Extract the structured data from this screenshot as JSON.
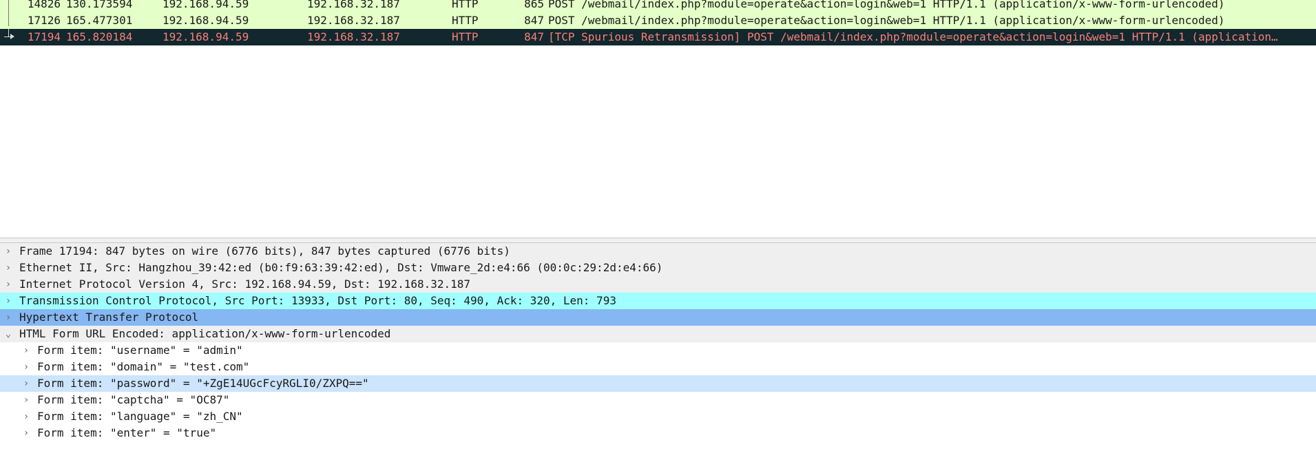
{
  "packet_list": {
    "rows": [
      {
        "no": "14826",
        "time": "130.173594",
        "src": "192.168.94.59",
        "dst": "192.168.32.187",
        "proto": "HTTP",
        "len": "865",
        "info": "POST /webmail/index.php?module=operate&action=login&web=1 HTTP/1.1  (application/x-www-form-urlencoded)"
      },
      {
        "no": "17126",
        "time": "165.477301",
        "src": "192.168.94.59",
        "dst": "192.168.32.187",
        "proto": "HTTP",
        "len": "847",
        "info": "POST /webmail/index.php?module=operate&action=login&web=1 HTTP/1.1  (application/x-www-form-urlencoded)"
      },
      {
        "no": "17194",
        "time": "165.820184",
        "src": "192.168.94.59",
        "dst": "192.168.32.187",
        "proto": "HTTP",
        "len": "847",
        "info": "[TCP Spurious Retransmission] POST /webmail/index.php?module=operate&action=login&web=1 HTTP/1.1  (application…"
      }
    ]
  },
  "packet_details": {
    "frame": "Frame 17194: 847 bytes on wire (6776 bits), 847 bytes captured (6776 bits)",
    "ethernet": "Ethernet II, Src: Hangzhou_39:42:ed (b0:f9:63:39:42:ed), Dst: Vmware_2d:e4:66 (00:0c:29:2d:e4:66)",
    "ip": "Internet Protocol Version 4, Src: 192.168.94.59, Dst: 192.168.32.187",
    "tcp": "Transmission Control Protocol, Src Port: 13933, Dst Port: 80, Seq: 490, Ack: 320, Len: 793",
    "http": "Hypertext Transfer Protocol",
    "form": "HTML Form URL Encoded: application/x-www-form-urlencoded",
    "form_items": [
      "Form item: \"username\" = \"admin\"",
      "Form item: \"domain\" = \"test.com\"",
      "Form item: \"password\" = \"+ZgE14UGcFcyRGLI0/ZXPQ==\"",
      "Form item: \"captcha\" = \"OC87\"",
      "Form item: \"language\" = \"zh_CN\"",
      "Form item: \"enter\" = \"true\""
    ]
  },
  "colors": {
    "http_row_bg": "#e4ffc7",
    "selected_row_bg": "#12272e",
    "selected_row_fg": "#f78077",
    "tcp_highlight": "#a0ffff",
    "http_highlight": "#85b7f2",
    "field_highlight": "#cce4fc"
  },
  "icons": {
    "collapsed": "chevron-right-icon",
    "expanded": "chevron-down-icon"
  }
}
